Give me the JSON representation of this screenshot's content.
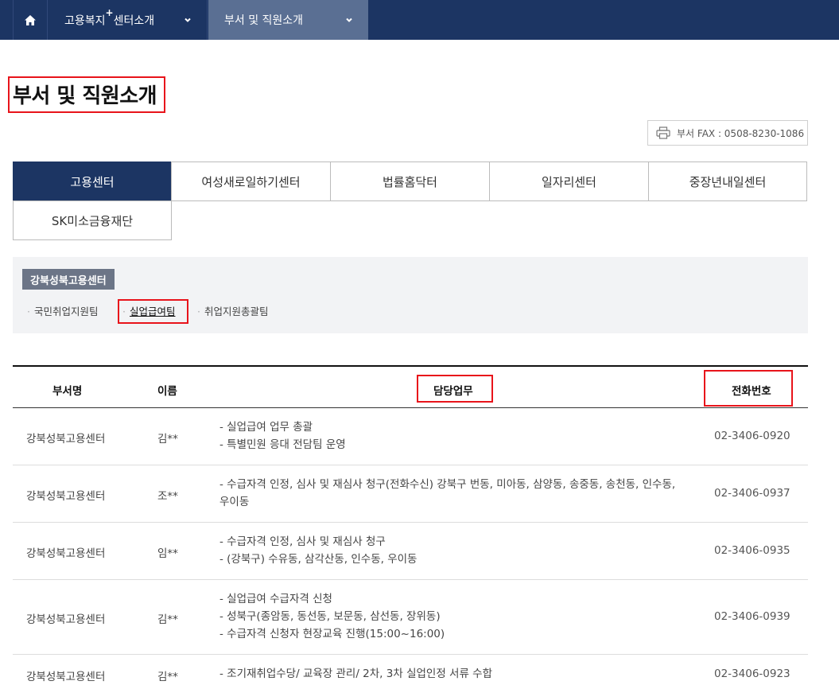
{
  "nav": {
    "home_icon": "home-icon",
    "menu1_label": "고용복지",
    "menu1_sup": "+",
    "menu1_suffix": "센터소개",
    "menu2_label": "부서 및 직원소개"
  },
  "page": {
    "title": "부서 및 직원소개",
    "fax_text": "부서 FAX : 0508-8230-1086"
  },
  "tabs": [
    {
      "label": "고용센터",
      "active": true
    },
    {
      "label": "여성새로일하기센터",
      "active": false
    },
    {
      "label": "법률홈닥터",
      "active": false
    },
    {
      "label": "일자리센터",
      "active": false
    },
    {
      "label": "중장년내일센터",
      "active": false
    },
    {
      "label": "SK미소금융재단",
      "active": false
    }
  ],
  "center": {
    "name": "강북성북고용센터",
    "teams": [
      "국민취업지원팀",
      "실업급여팀",
      "취업지원총괄팀"
    ],
    "selected_team": "실업급여팀"
  },
  "table": {
    "headers": [
      "부서명",
      "이름",
      "담당업무",
      "전화번호"
    ],
    "rows": [
      {
        "dept": "강북성북고용센터",
        "name": "김**",
        "duties": [
          "- 실업급여 업무 총괄",
          "- 특별민원 응대 전담팀 운영"
        ],
        "phone": "02-3406-0920"
      },
      {
        "dept": "강북성북고용센터",
        "name": "조**",
        "duties": [
          "- 수급자격 인정, 심사 및 재심사 청구(전화수신) 강북구 번동, 미아동, 삼양동, 송중동, 송천동, 인수동,",
          "우이동"
        ],
        "phone": "02-3406-0937"
      },
      {
        "dept": "강북성북고용센터",
        "name": "임**",
        "duties": [
          "- 수급자격 인정, 심사 및 재심사 청구",
          "- (강북구) 수유동, 삼각산동, 인수동, 우이동"
        ],
        "phone": "02-3406-0935"
      },
      {
        "dept": "강북성북고용센터",
        "name": "김**",
        "duties": [
          "- 실업급여 수급자격 신청",
          "- 성북구(종암동, 동선동, 보문동, 삼선동, 장위동)",
          "- 수급자격 신청자 현장교육 진행(15:00~16:00)"
        ],
        "phone": "02-3406-0939"
      },
      {
        "dept": "강북성북고용센터",
        "name": "김**",
        "duties": [
          "- 조기재취업수당/ 교육장 관리/ 2차, 3차 실업인정 서류 수합"
        ],
        "phone": "02-3406-0923"
      }
    ]
  },
  "colors": {
    "nav_bg": "#1c3563",
    "nav_active": "#5a6f93",
    "highlight_red": "#e8141b",
    "badge_bg": "#6c7587"
  }
}
